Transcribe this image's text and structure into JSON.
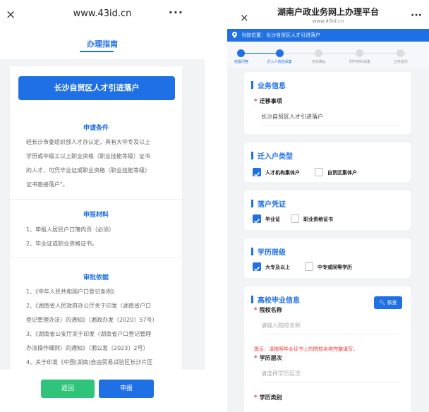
{
  "left": {
    "header": {
      "close": "×",
      "title": "www.43id.cn",
      "more": "···"
    },
    "tab": "办理指南",
    "banner": "长沙自贸区人才引进落户",
    "sections": [
      {
        "title": "申请条件",
        "lines": [
          "经长沙市委组织部人才办认定，具有大中专及以上",
          "学历或中级工以上职业资格（职业技能等级）证书",
          "的人才，可凭毕业证或职业资格（职业技能等级）",
          "证书直接落户\"。"
        ]
      },
      {
        "title": "申报材料",
        "lines": [
          "1、申报人居民户口簿内页（必须）",
          "2、毕业证或职业资格证书。"
        ]
      },
      {
        "title": "审批依据",
        "lines": [
          "1、《中华人民共和国户口登记条例》",
          "2、《湖南省人民政府办公厅关于印发〈湖南省户口",
          "登记管理办法〉的通知》（湘政办发〔2020〕57号）",
          "3、《湖南省公安厅关于印发〈湖南省户口登记管理",
          "办法操作细则〉的通知》（湘公发〔2023〕2号）",
          "4、关于印发《中国(湖南)自由贸易试验区长沙片区"
        ]
      }
    ],
    "buttons": {
      "back": "返回",
      "apply": "申报"
    }
  },
  "right": {
    "header": {
      "close": "×",
      "title": "湖南户政业务网上办理平台",
      "subtitle": "www.43id.cn",
      "more": "···"
    },
    "location": "当前位置：长沙自贸区人才引进落户",
    "steps": [
      {
        "label": "前置问答",
        "state": "done"
      },
      {
        "label": "迁入人信息采集",
        "state": "done"
      },
      {
        "label": "信息确认",
        "state": "todo"
      },
      {
        "label": "附件材料采集",
        "state": "todo"
      },
      {
        "label": "业务提交",
        "state": "todo"
      }
    ],
    "business": {
      "title": "业务信息",
      "field_label": "迁移事项",
      "field_value": "长沙自贸区人才引进落户"
    },
    "household_type": {
      "title": "迁入户类型",
      "options": [
        {
          "label": "人才机构集体户",
          "checked": true
        },
        {
          "label": "自贸区集体户",
          "checked": false
        }
      ]
    },
    "credential": {
      "title": "落户凭证",
      "options": [
        {
          "label": "毕业证",
          "checked": true
        },
        {
          "label": "职业资格证书",
          "checked": false
        }
      ]
    },
    "education": {
      "title": "学历层级",
      "options": [
        {
          "label": "大专及以上",
          "checked": true
        },
        {
          "label": "中专或同等学历",
          "checked": false
        }
      ]
    },
    "college": {
      "title": "高校毕业信息",
      "check_button": "核查",
      "school_label": "院校名称",
      "school_placeholder": "请输入院校名称",
      "hint": "提示：请按照毕业证书上的院校名称完整填写。",
      "level_label": "学历层次",
      "level_placeholder": "请选择学历层次",
      "category_label": "学历类别"
    }
  },
  "colors": {
    "primary": "#1f6fe5",
    "green": "#2fc47a",
    "required": "#e53935"
  }
}
